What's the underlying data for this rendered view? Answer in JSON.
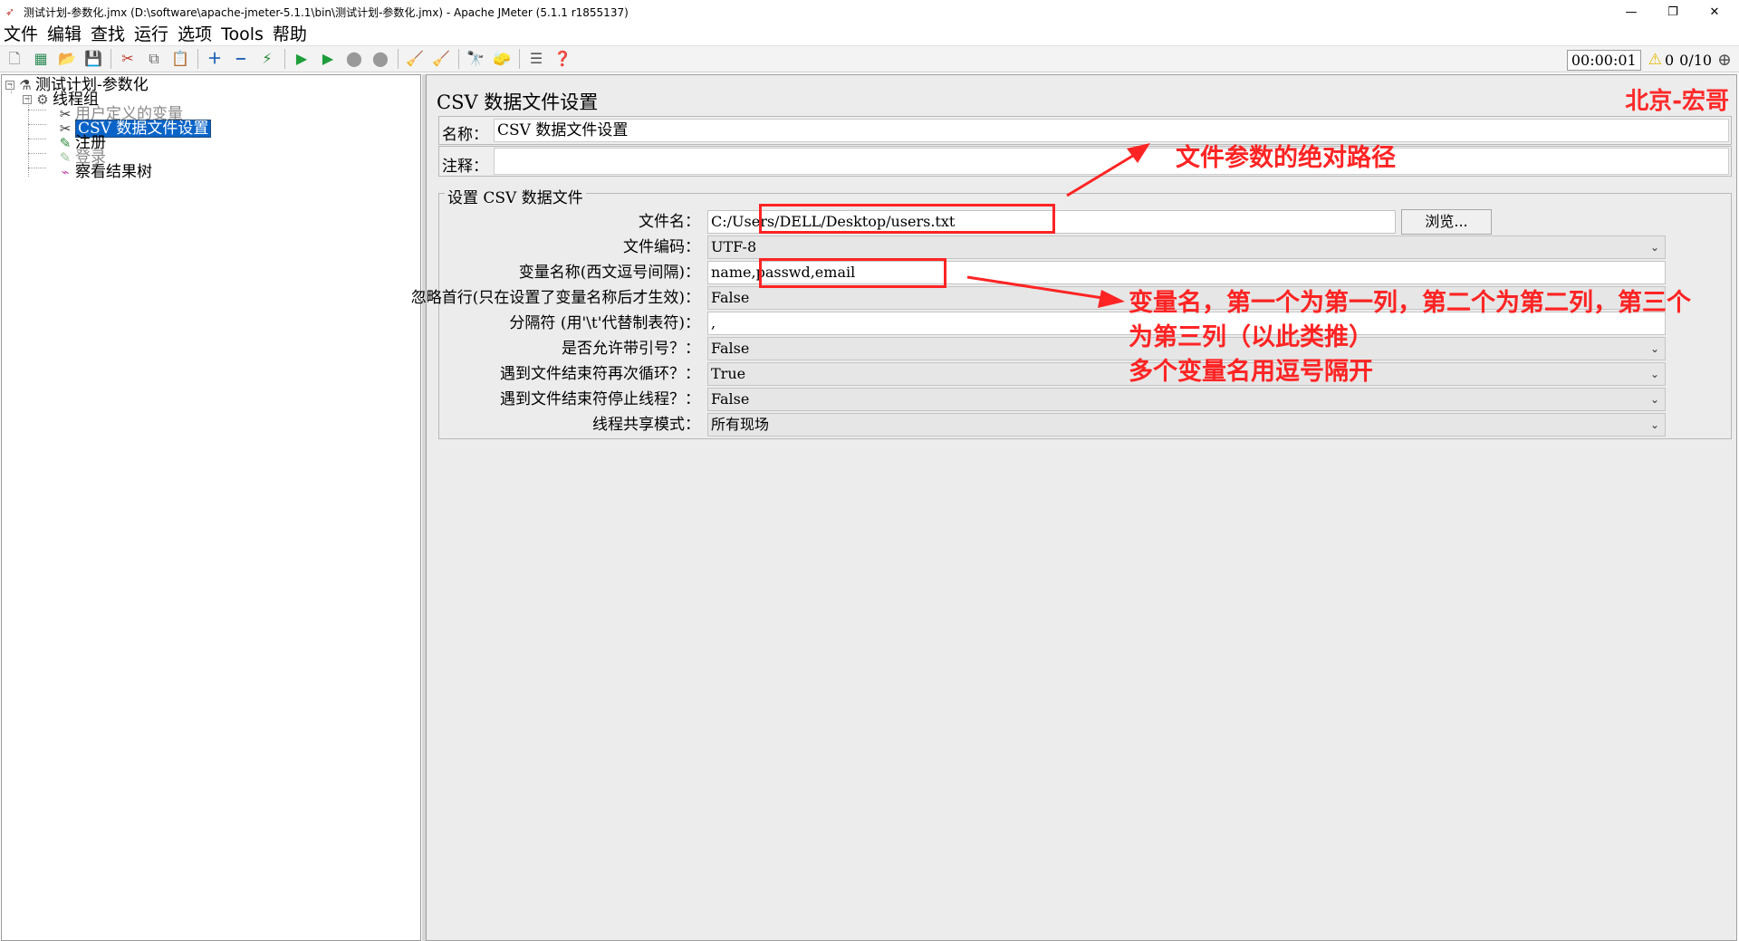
{
  "window": {
    "title": "测试计划-参数化.jmx (D:\\software\\apache-jmeter-5.1.1\\bin\\测试计划-参数化.jmx) - Apache JMeter (5.1.1 r1855137)",
    "minimize": "—",
    "maximize": "❐",
    "close": "✕"
  },
  "menu": {
    "items": [
      "文件",
      "编辑",
      "查找",
      "运行",
      "选项",
      "Tools",
      "帮助"
    ]
  },
  "toolbar": {
    "timer": "00:00:01",
    "warning_count": "0",
    "threads": "0/10"
  },
  "tree": {
    "root": "测试计划-参数化",
    "thread_group": "线程组",
    "user_vars": "用户定义的变量",
    "csv": "CSV 数据文件设置",
    "register": "注册",
    "login": "登录",
    "result_tree": "察看结果树"
  },
  "panel": {
    "title": "CSV 数据文件设置",
    "name_label": "名称：",
    "name_value": "CSV 数据文件设置",
    "comment_label": "注释：",
    "comment_value": "",
    "group_title": "设置 CSV 数据文件",
    "fields": {
      "filename_label": "文件名：",
      "filename_value": "C:/Users/DELL/Desktop/users.txt",
      "browse": "浏览...",
      "encoding_label": "文件编码：",
      "encoding_value": "UTF-8",
      "varnames_label": "变量名称(西文逗号间隔)：",
      "varnames_value": "name,passwd,email",
      "ignore_label": "忽略首行(只在设置了变量名称后才生效)：",
      "ignore_value": "False",
      "delimiter_label": "分隔符 (用'\\t'代替制表符)：",
      "delimiter_value": ",",
      "quoted_label": "是否允许带引号？：",
      "quoted_value": "False",
      "recycle_label": "遇到文件结束符再次循环？：",
      "recycle_value": "True",
      "stop_label": "遇到文件结束符停止线程？：",
      "stop_value": "False",
      "sharing_label": "线程共享模式：",
      "sharing_value": "所有现场"
    }
  },
  "annotations": {
    "brand": "北京-宏哥",
    "path_note": "文件参数的绝对路径",
    "var_note_1": "变量名，第一个为第一列，第二个为第二列，第三个",
    "var_note_2": "为第三列（以此类推）",
    "var_note_3": "多个变量名用逗号隔开",
    "red_color": "#ff2424"
  }
}
